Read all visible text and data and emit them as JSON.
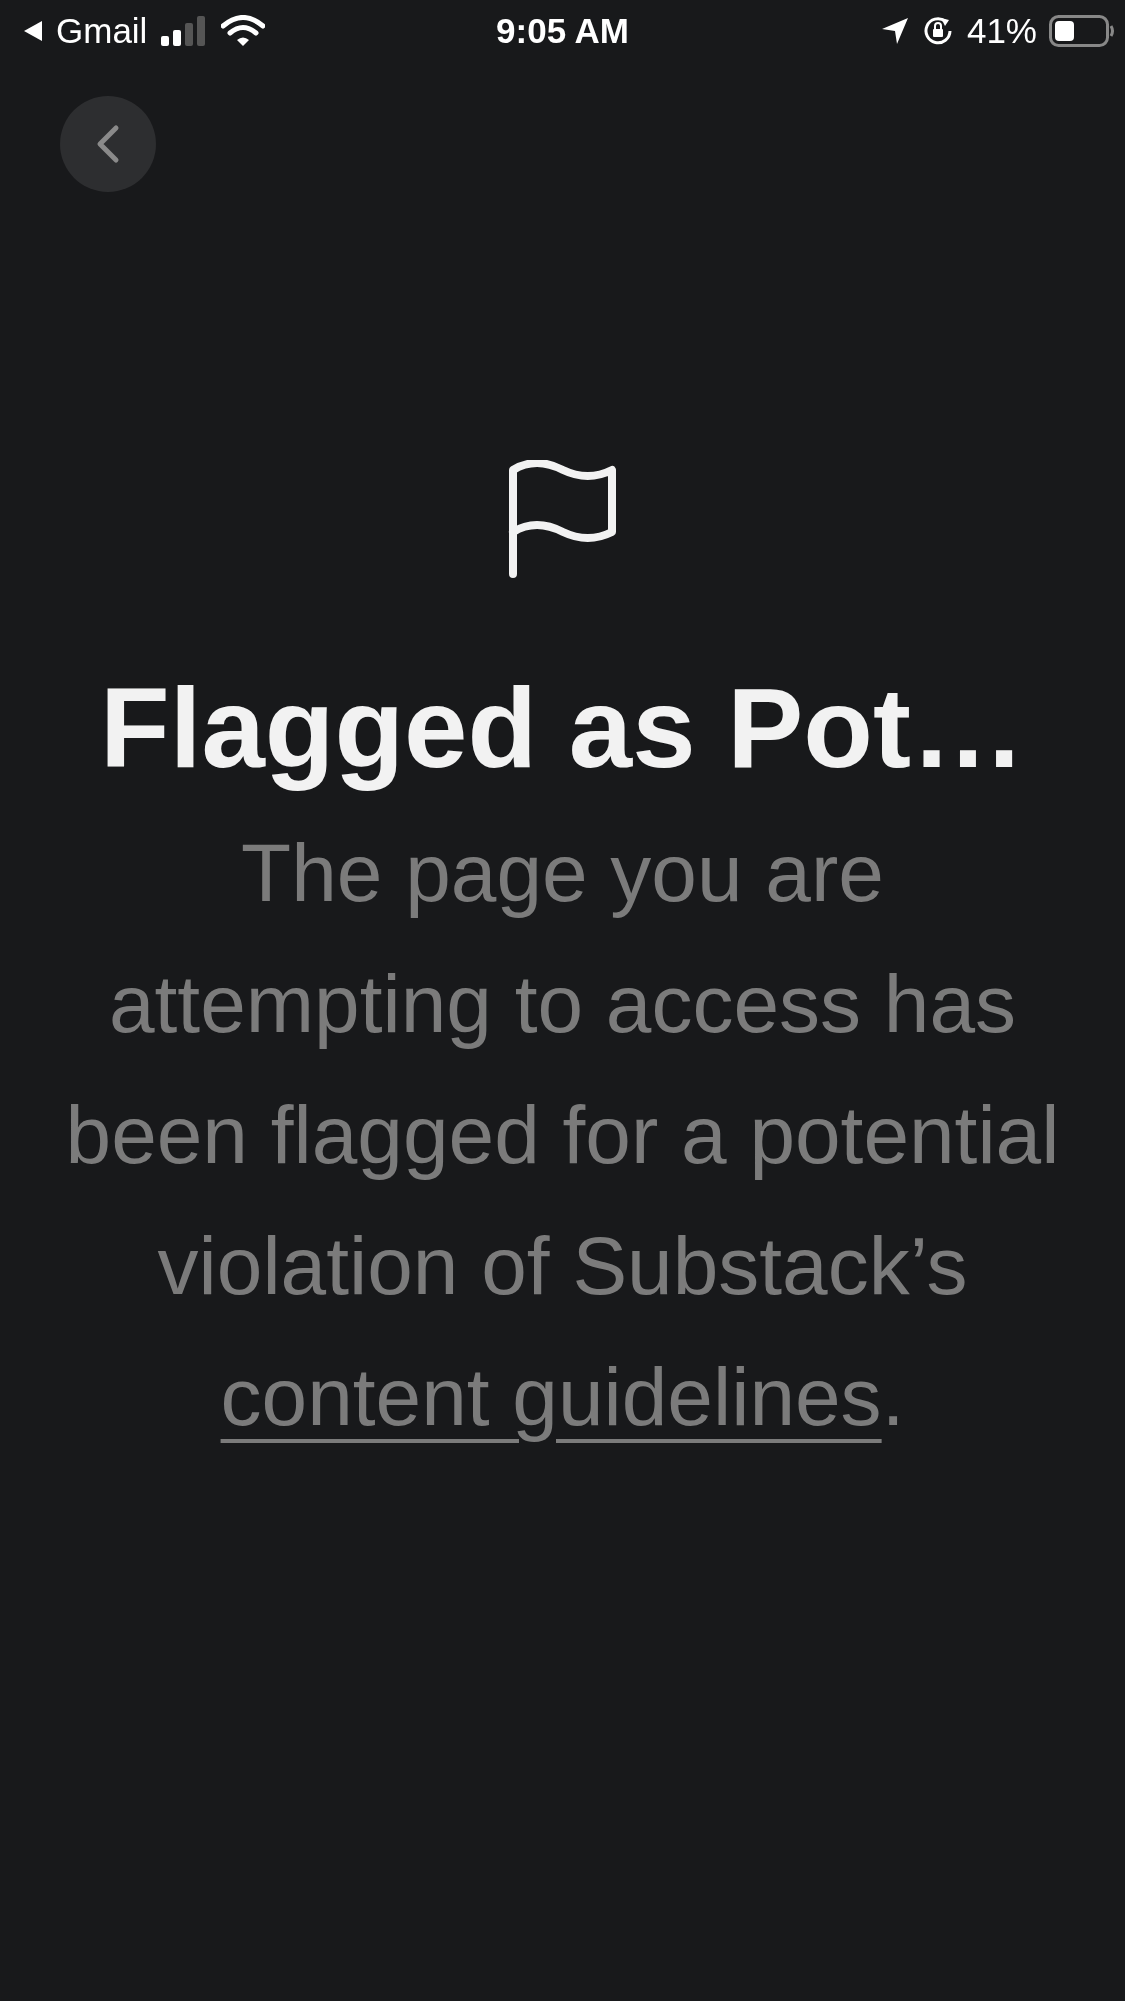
{
  "status_bar": {
    "back_app": "Gmail",
    "time": "9:05 AM",
    "battery": "41%"
  },
  "title": "Flagged as Pot…",
  "message": {
    "text": "The page you are attempting to access has been flagged for a potential violation of Substack’s ",
    "link": "content guidelines",
    "end": "."
  }
}
